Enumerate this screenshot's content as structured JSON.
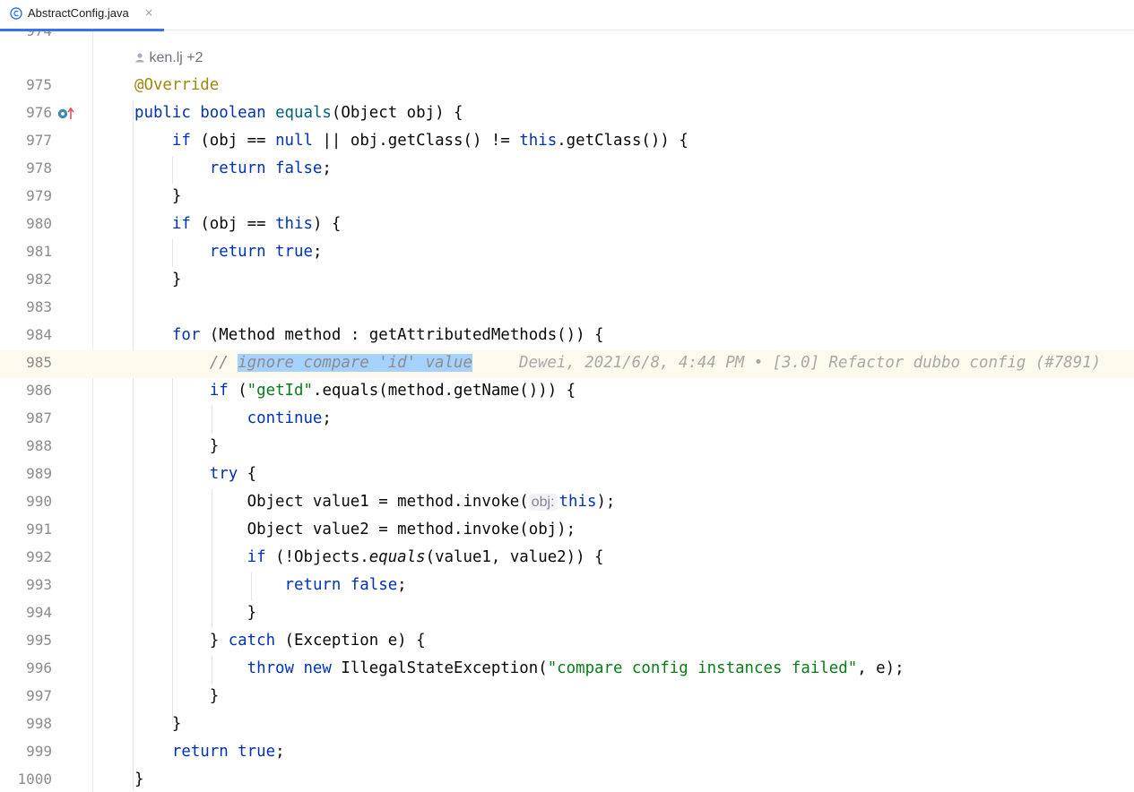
{
  "tab": {
    "title": "AbstractConfig.java",
    "close": "×",
    "icon": "java-class-icon",
    "accent": "#3574f0"
  },
  "editor": {
    "partial_line_number": "974",
    "author_hint": "ken.lj +2",
    "current_line": "985",
    "blame": "Dewei, 2021/6/8, 4:44 PM • [3.0] Refactor dubbo config (#7891)",
    "param_hint": "obj:",
    "gutter_icon": "implements-override-icon",
    "lines": [
      {
        "num": "975",
        "text": "@Override"
      },
      {
        "num": "976",
        "text": "public boolean equals(Object obj) {"
      },
      {
        "num": "977",
        "text": "    if (obj == null || obj.getClass() != this.getClass()) {"
      },
      {
        "num": "978",
        "text": "        return false;"
      },
      {
        "num": "979",
        "text": "    }"
      },
      {
        "num": "980",
        "text": "    if (obj == this) {"
      },
      {
        "num": "981",
        "text": "        return true;"
      },
      {
        "num": "982",
        "text": "    }"
      },
      {
        "num": "983",
        "text": ""
      },
      {
        "num": "984",
        "text": "    for (Method method : getAttributedMethods()) {"
      },
      {
        "num": "985",
        "text": "        // ignore compare 'id' value"
      },
      {
        "num": "986",
        "text": "        if (\"getId\".equals(method.getName())) {"
      },
      {
        "num": "987",
        "text": "            continue;"
      },
      {
        "num": "988",
        "text": "        }"
      },
      {
        "num": "989",
        "text": "        try {"
      },
      {
        "num": "990",
        "text": "            Object value1 = method.invoke(obj: this);"
      },
      {
        "num": "991",
        "text": "            Object value2 = method.invoke(obj);"
      },
      {
        "num": "992",
        "text": "            if (!Objects.equals(value1, value2)) {"
      },
      {
        "num": "993",
        "text": "                return false;"
      },
      {
        "num": "994",
        "text": "            }"
      },
      {
        "num": "995",
        "text": "        } catch (Exception e) {"
      },
      {
        "num": "996",
        "text": "            throw new IllegalStateException(\"compare config instances failed\", e);"
      },
      {
        "num": "997",
        "text": "        }"
      },
      {
        "num": "998",
        "text": "    }"
      },
      {
        "num": "999",
        "text": "    return true;"
      },
      {
        "num": "1000",
        "text": "}"
      }
    ]
  }
}
